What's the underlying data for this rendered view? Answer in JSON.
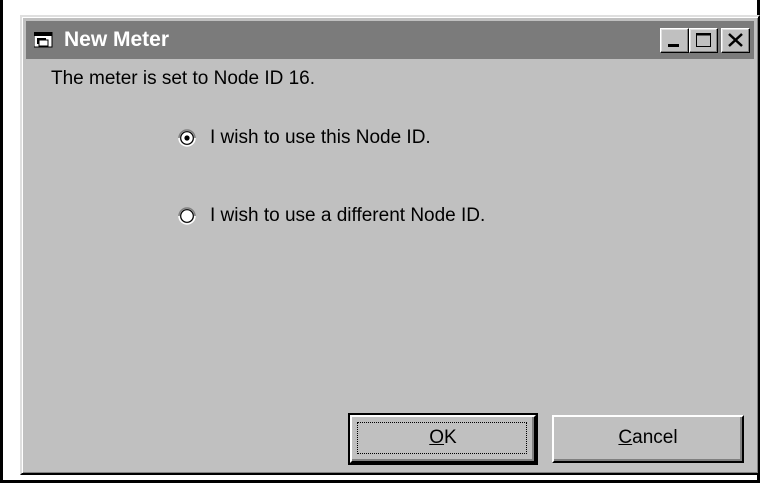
{
  "window": {
    "title": "New Meter",
    "icon": "window-app-icon"
  },
  "titlebar_buttons": {
    "minimize_icon": "minimize-icon",
    "maximize_icon": "maximize-icon",
    "close_icon": "close-icon"
  },
  "message": "The meter is set to Node ID 16.",
  "options": [
    {
      "label": "I wish to use this Node ID.",
      "selected": true
    },
    {
      "label": "I wish to use a different Node ID.",
      "selected": false
    }
  ],
  "buttons": {
    "ok_accel": "O",
    "ok_rest": "K",
    "cancel_accel": "C",
    "cancel_rest": "ancel"
  },
  "colors": {
    "titlebar_inactive": "#7b7b7b",
    "face": "#c0c0c0"
  }
}
